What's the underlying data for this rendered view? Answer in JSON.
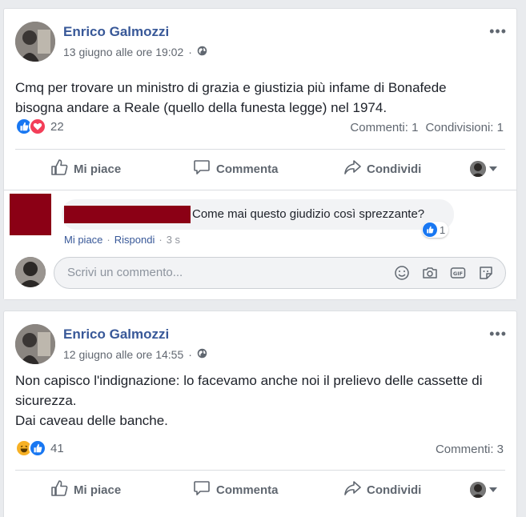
{
  "posts": [
    {
      "author": "Enrico Galmozzi",
      "timestamp": "13 giugno alle ore 19:02",
      "text_lines": [
        "Cmq per trovare un ministro di grazia e giustizia più infame di Bonafede",
        "bisogna andare a Reale (quello della funesta legge) nel 1974."
      ],
      "reactions": [
        "like",
        "love"
      ],
      "reaction_count": "22",
      "comments_count": "Commenti: 1",
      "shares_count": "Condivisioni: 1",
      "actions": {
        "like": "Mi piace",
        "comment": "Commenta",
        "share": "Condividi"
      },
      "comment": {
        "text": "Come mai questo giudizio così sprezzante?",
        "reaction_count": "1",
        "like_link": "Mi piace",
        "separator": "·",
        "reply_link": "Rispondi",
        "time": "3 s"
      },
      "comment_input_placeholder": "Scrivi un commento..."
    },
    {
      "author": "Enrico Galmozzi",
      "timestamp": "12 giugno alle ore 14:55",
      "text_lines": [
        "Non capisco l'indignazione: lo facevamo anche noi il prelievo delle cassette di",
        "sicurezza.",
        "Dai caveau delle banche."
      ],
      "reactions": [
        "haha",
        "like"
      ],
      "reaction_count": "41",
      "comments_count": "Commenti: 3",
      "actions": {
        "like": "Mi piace",
        "comment": "Commenta",
        "share": "Condividi"
      }
    }
  ],
  "colors": {
    "link": "#385898",
    "like": "#1877f2",
    "love": "#f33e58",
    "haha": "#f7b125",
    "redacted": "#8b0015"
  }
}
